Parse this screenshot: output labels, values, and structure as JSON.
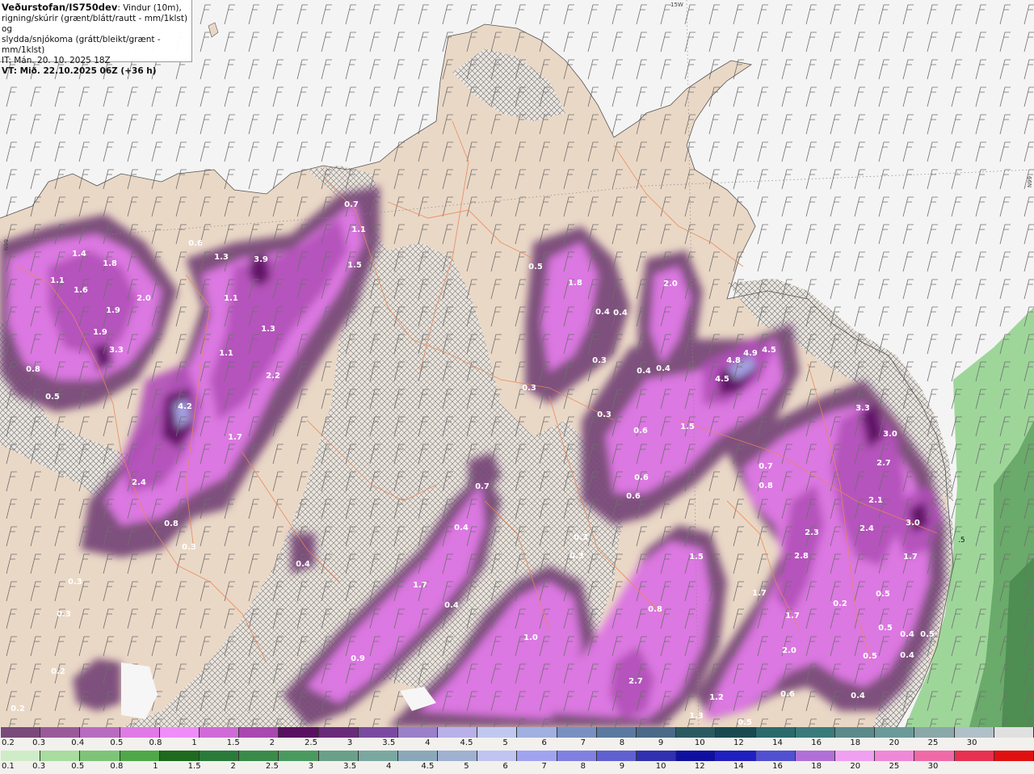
{
  "header": {
    "org": "Veðurstofan/IS750dev",
    "subtitle1": ": Vindur (10m),",
    "line2": "rigning/skúrir (grænt/blátt/rautt - mm/1klst) og",
    "line3": "slydda/snjókoma (grátt/bleikt/grænt - mm/1klst)",
    "init_time": "IT: Mán. 20. 10. 2025 18Z",
    "valid_time": "VT: Mið. 22.10.2025 06Z (+36 h)"
  },
  "map_labels": {
    "lon_15w": "15W",
    "lat_66n": "66N",
    "lat_66n_left": "66N",
    "coast_5": ".5"
  },
  "precip_values": [
    {
      "text": "0.7"
    },
    {
      "text": "1.1"
    },
    {
      "text": "1.5"
    },
    {
      "text": "0.6"
    },
    {
      "text": "1.3"
    },
    {
      "text": "3.9"
    },
    {
      "text": "1.4"
    },
    {
      "text": "1.8"
    },
    {
      "text": "1.1"
    },
    {
      "text": "1.6"
    },
    {
      "text": "1.9"
    },
    {
      "text": "2.0"
    },
    {
      "text": "1.9"
    },
    {
      "text": "3.3"
    },
    {
      "text": "0.8"
    },
    {
      "text": "0.5"
    },
    {
      "text": "1.1"
    },
    {
      "text": "1.3"
    },
    {
      "text": "1.1"
    },
    {
      "text": "2.2"
    },
    {
      "text": "4.2"
    },
    {
      "text": "1.7"
    },
    {
      "text": "2.4"
    },
    {
      "text": "0.8"
    },
    {
      "text": "0.3"
    },
    {
      "text": "0.3"
    },
    {
      "text": "0.3"
    },
    {
      "text": "0.2"
    },
    {
      "text": "0.4"
    },
    {
      "text": "0.2"
    },
    {
      "text": "0.5"
    },
    {
      "text": "1.8"
    },
    {
      "text": "0.4"
    },
    {
      "text": "0.4"
    },
    {
      "text": "2.0"
    },
    {
      "text": "0.3"
    },
    {
      "text": "0.4"
    },
    {
      "text": "0.4"
    },
    {
      "text": "0.3"
    },
    {
      "text": "0.3"
    },
    {
      "text": "0.6"
    },
    {
      "text": "1.5"
    },
    {
      "text": "0.6"
    },
    {
      "text": "0.6"
    },
    {
      "text": "4.8"
    },
    {
      "text": "4.9"
    },
    {
      "text": "4.5"
    },
    {
      "text": "4.5"
    },
    {
      "text": "0.7"
    },
    {
      "text": "0.4"
    },
    {
      "text": "1.7"
    },
    {
      "text": "0.4"
    },
    {
      "text": "0.9"
    },
    {
      "text": "1.0"
    },
    {
      "text": "0.8"
    },
    {
      "text": "2.7"
    },
    {
      "text": "1.5"
    },
    {
      "text": "0.3"
    },
    {
      "text": "0.3"
    },
    {
      "text": "3.3"
    },
    {
      "text": "3.0"
    },
    {
      "text": "2.7"
    },
    {
      "text": "0.7"
    },
    {
      "text": "0.8"
    },
    {
      "text": "2.1"
    },
    {
      "text": "2.3"
    },
    {
      "text": "2.4"
    },
    {
      "text": "3.0"
    },
    {
      "text": "2.8"
    },
    {
      "text": "1.7"
    },
    {
      "text": "1.7"
    },
    {
      "text": "1.7"
    },
    {
      "text": "0.5"
    },
    {
      "text": "2.0"
    },
    {
      "text": "0.5"
    },
    {
      "text": "0.4"
    },
    {
      "text": "0.5"
    },
    {
      "text": "0.4"
    },
    {
      "text": "0.4"
    },
    {
      "text": "0.6"
    },
    {
      "text": "1.2"
    },
    {
      "text": "1.3"
    },
    {
      "text": "0.5"
    },
    {
      "text": "0.5"
    },
    {
      "text": "0.2"
    }
  ],
  "colorbars": {
    "snow": {
      "labels": [
        "0.2",
        "0.3",
        "0.4",
        "0.5",
        "0.8",
        "1",
        "1.5",
        "2",
        "2.5",
        "3",
        "3.5",
        "4",
        "4.5",
        "5",
        "6",
        "7",
        "8",
        "9",
        "10",
        "12",
        "14",
        "16",
        "18",
        "20",
        "25",
        "30"
      ],
      "colors": [
        "#7a4a7a",
        "#9a5a9a",
        "#b86cc0",
        "#e07ae6",
        "#f08cf8",
        "#d06ad8",
        "#a848b0",
        "#5a1060",
        "#6a2a7a",
        "#7a4aa0",
        "#9a80c8",
        "#b8b0e8",
        "#c0c8f0",
        "#a0b0e0",
        "#7890c0",
        "#5a7aa0",
        "#4a6a88",
        "#2a5a60",
        "#1a4a50",
        "#2a6a6a",
        "#3a7a7a",
        "#5a8a8a",
        "#6a9a9a",
        "#8aa8a8",
        "#b0c0c8",
        "#e0e0e0"
      ]
    },
    "rain": {
      "labels": [
        "0.1",
        "0.3",
        "0.5",
        "0.8",
        "1",
        "1.5",
        "2",
        "2.5",
        "3",
        "3.5",
        "4",
        "4.5",
        "5",
        "6",
        "7",
        "8",
        "9",
        "10",
        "12",
        "14",
        "16",
        "18",
        "20",
        "25",
        "30"
      ],
      "colors": [
        "#cfecc8",
        "#a8dca0",
        "#7ec478",
        "#4ea848",
        "#1e6a1e",
        "#2a7a3a",
        "#3a8a4a",
        "#4a9a60",
        "#6aa08a",
        "#7aa8a0",
        "#8aa8b8",
        "#a0b0d0",
        "#c0c4f0",
        "#a0a4f0",
        "#8080e0",
        "#6060d0",
        "#3030b0",
        "#1010a0",
        "#2020c0",
        "#5050d0",
        "#b070d8",
        "#f0a0f0",
        "#f088d8",
        "#f06aa8",
        "#e83050",
        "#e01010"
      ]
    }
  }
}
